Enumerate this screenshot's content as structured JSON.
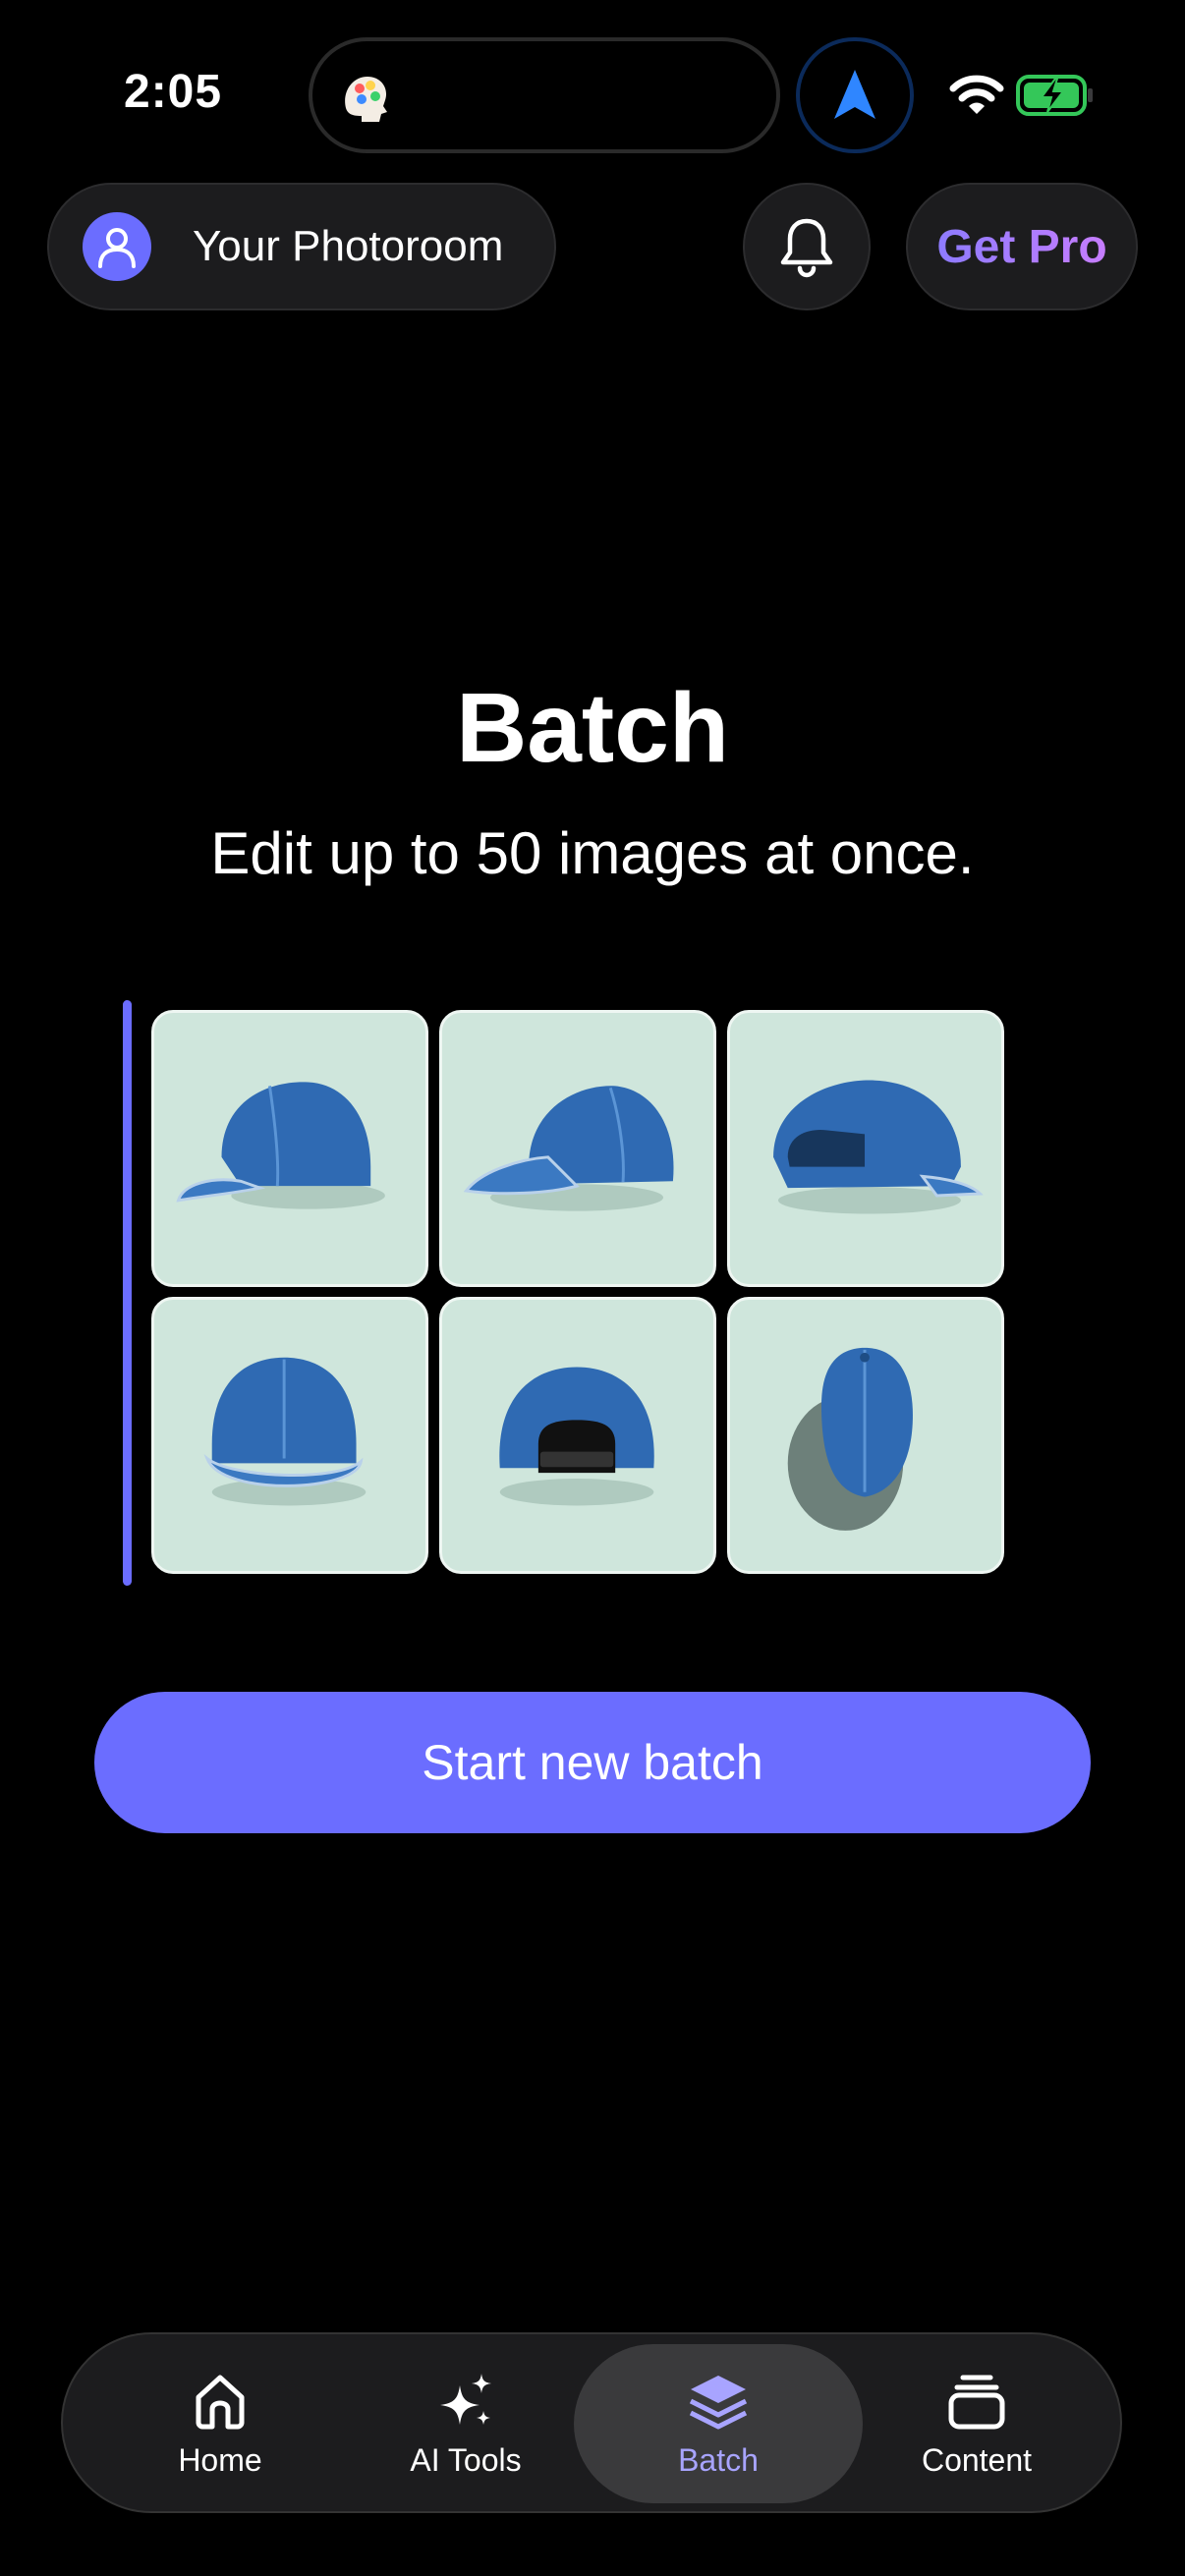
{
  "status_bar": {
    "time": "2:05"
  },
  "header": {
    "account_label": "Your Photoroom",
    "get_pro_label": "Get Pro"
  },
  "main": {
    "title": "Batch",
    "subtitle": "Edit up to 50 images at once.",
    "cta_label": "Start new batch",
    "accent_color": "#6b6dff"
  },
  "tab_bar": {
    "items": [
      {
        "label": "Home",
        "icon": "home-icon"
      },
      {
        "label": "AI Tools",
        "icon": "sparkles-icon"
      },
      {
        "label": "Batch",
        "icon": "layers-icon",
        "active": true
      },
      {
        "label": "Content",
        "icon": "stack-icon"
      }
    ]
  }
}
